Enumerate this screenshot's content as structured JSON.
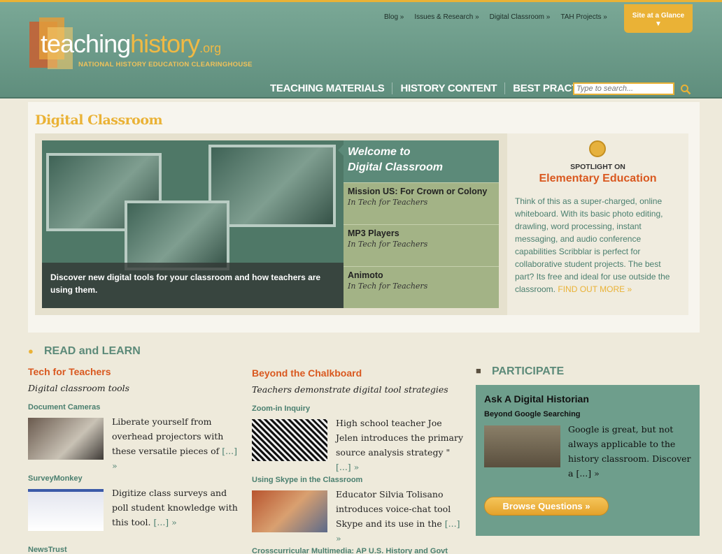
{
  "brand": {
    "logo_part1": "teaching",
    "logo_part2": "history",
    "logo_part3": ".org",
    "tagline": "NATIONAL HISTORY EDUCATION CLEARINGHOUSE",
    "accent": "#eab236",
    "header_green": "#6e9e8c",
    "orange": "#d9581f"
  },
  "topnav": [
    "Blog",
    "Issues & Research",
    "Digital Classroom",
    "TAH Projects"
  ],
  "site_at_glance": "Site at a Glance",
  "mainnav": [
    "TEACHING MATERIALS",
    "HISTORY CONTENT",
    "BEST PRACTICES"
  ],
  "search": {
    "placeholder": "Type to search..."
  },
  "feature": {
    "title": "Digital Classroom",
    "caption": "Discover new digital tools for your classroom and how teachers are using them.",
    "welcome_line1": "Welcome to",
    "welcome_line2": "Digital Classroom",
    "items": [
      {
        "title": "Mission US: For Crown or Colony",
        "section": "In Tech for Teachers"
      },
      {
        "title": "MP3 Players",
        "section": "In Tech for Teachers"
      },
      {
        "title": "Animoto",
        "section": "In Tech for Teachers"
      }
    ],
    "spotlight": {
      "label": "SPOTLIGHT ON",
      "title": "Elementary Education",
      "text": "Think of this as a super-charged, online whiteboard. With its basic photo editing, drawling, word processing, instant messaging, and audio conference capabilities Scribblar is perfect for collaborative student projects. The best part? Its free and ideal for use outside the classroom.",
      "more": "FIND OUT MORE »"
    }
  },
  "read_learn": {
    "heading": "READ and LEARN",
    "col1": {
      "title": "Tech for Teachers",
      "subtitle": "Digital classroom tools",
      "articles": [
        {
          "title": "Document Cameras",
          "text": "Liberate yourself from overhead projectors with these versatile pieces of",
          "more": "[...] »"
        },
        {
          "title": "SurveyMonkey",
          "text": "Digitize class surveys and poll student knowledge with this tool.",
          "more": "[...] »"
        },
        {
          "title": "NewsTrust"
        }
      ]
    },
    "col2": {
      "title": "Beyond the Chalkboard",
      "subtitle": "Teachers demonstrate digital tool strategies",
      "articles": [
        {
          "title": "Zoom-in Inquiry",
          "text": "High school teacher Joe Jelen introduces the primary source analysis strategy \"",
          "more": "[...] »"
        },
        {
          "title": "Using Skype in the Classroom",
          "text": "Educator Silvia Tolisano introduces voice-chat tool Skype and its use in the",
          "more": "[...] »"
        },
        {
          "title": "Crosscurricular Multimedia: AP U.S. History and Govt"
        }
      ]
    }
  },
  "participate": {
    "heading": "PARTICIPATE",
    "title": "Ask A Digital Historian",
    "subtitle": "Beyond Google Searching",
    "text": "Google is great, but not always applicable to the history classroom. Discover a",
    "more": "[...] »",
    "button": "Browse Questions »"
  }
}
